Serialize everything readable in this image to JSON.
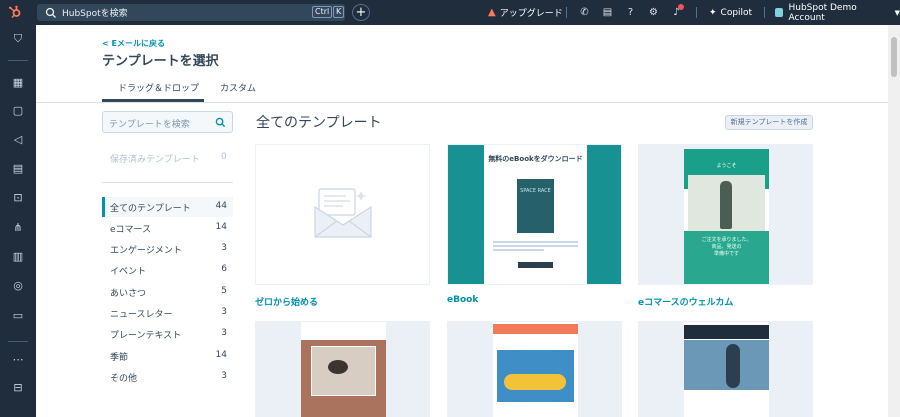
{
  "topbar": {
    "search_placeholder": "HubSpotを検索",
    "kbd_ctrl": "Ctrl",
    "kbd_k": "K",
    "upgrade": "アップグレード",
    "copilot": "Copilot",
    "account": "HubSpot Demo Account",
    "icons": [
      "hubspot-logo-icon",
      "search-icon",
      "plus-icon",
      "rocket-icon",
      "phone-icon",
      "marketplace-icon",
      "help-icon",
      "gear-icon",
      "bell-icon",
      "sparkle-icon",
      "chevron-down-icon"
    ],
    "brand_color": "#ff7a59",
    "bg_color": "#1f2d3d"
  },
  "sidebar": {
    "icons": [
      "bookmark-icon",
      "grid-icon",
      "contacts-icon",
      "megaphone-icon",
      "content-icon",
      "commerce-icon",
      "workflow-icon",
      "reports-icon",
      "data-icon",
      "library-icon",
      "ellipsis-icon",
      "expand-icon"
    ]
  },
  "header": {
    "back_link": "< Eメールに戻る",
    "title": "テンプレートを選択"
  },
  "tabs": [
    {
      "label": "ドラッグ＆ドロップ",
      "active": true
    },
    {
      "label": "カスタム",
      "active": false
    }
  ],
  "left": {
    "search_placeholder": "テンプレートを検索",
    "saved": {
      "label": "保存済みテンプレート",
      "count": "0"
    },
    "categories": [
      {
        "label": "全てのテンプレート",
        "count": "44",
        "active": true
      },
      {
        "label": "eコマース",
        "count": "14"
      },
      {
        "label": "エンゲージメント",
        "count": "3"
      },
      {
        "label": "イベント",
        "count": "6"
      },
      {
        "label": "あいさつ",
        "count": "5"
      },
      {
        "label": "ニュースレター",
        "count": "3"
      },
      {
        "label": "プレーンテキスト",
        "count": "3"
      },
      {
        "label": "季節",
        "count": "14"
      },
      {
        "label": "その他",
        "count": "3"
      }
    ]
  },
  "content": {
    "section_title": "全てのテンプレート",
    "new_template_button": "新規テンプレートを作成",
    "cards": [
      {
        "name": "ゼロから始める"
      },
      {
        "name": "eBook",
        "preview_title": "無料のeBookをダウンロード",
        "book_cover": "SPACE RACE"
      },
      {
        "name": "eコマースのウェルカム",
        "preview_title": "ようこそ",
        "preview_text": "ご注文を承りました。\n商品、発送の\n準備中です"
      }
    ],
    "accent_color": "#0091ae"
  }
}
